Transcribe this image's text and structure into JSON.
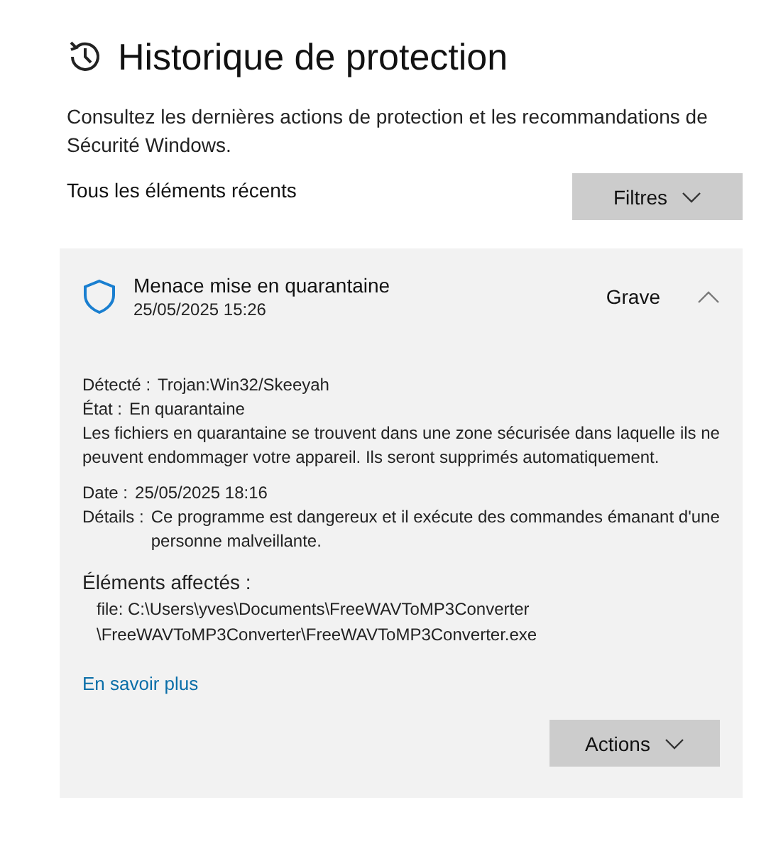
{
  "page": {
    "title": "Historique de protection",
    "description": "Consultez les dernières actions de protection et les recommandations de Sécurité Windows."
  },
  "list_header": {
    "label": "Tous les éléments récents",
    "filter_button": "Filtres"
  },
  "items": [
    {
      "title": "Menace mise en quarantaine",
      "timestamp": "25/05/2025 15:26",
      "severity": "Grave",
      "expanded": true,
      "fields": [
        {
          "label": "Détecté :",
          "value": "Trojan:Win32/Skeeyah"
        },
        {
          "label": "État :",
          "value": "En quarantaine"
        }
      ],
      "note": "Les fichiers en quarantaine se trouvent dans une zone sécurisée dans laquelle ils ne peuvent endommager votre appareil. Ils seront supprimés automatiquement.",
      "fields2": [
        {
          "label": "Date :",
          "value": "25/05/2025 18:16"
        },
        {
          "label": "Détails :",
          "value": "Ce programme est dangereux et il exécute des commandes émanant d'une personne malveillante."
        }
      ],
      "affected_heading": "Éléments affectés :",
      "affected_path": [
        "file: C:\\Users\\yves\\Documents\\FreeWAVToMP3Converter",
        "\\FreeWAVToMP3Converter\\FreeWAVToMP3Converter.exe"
      ],
      "link": "En savoir plus",
      "actions_button": "Actions"
    }
  ]
}
